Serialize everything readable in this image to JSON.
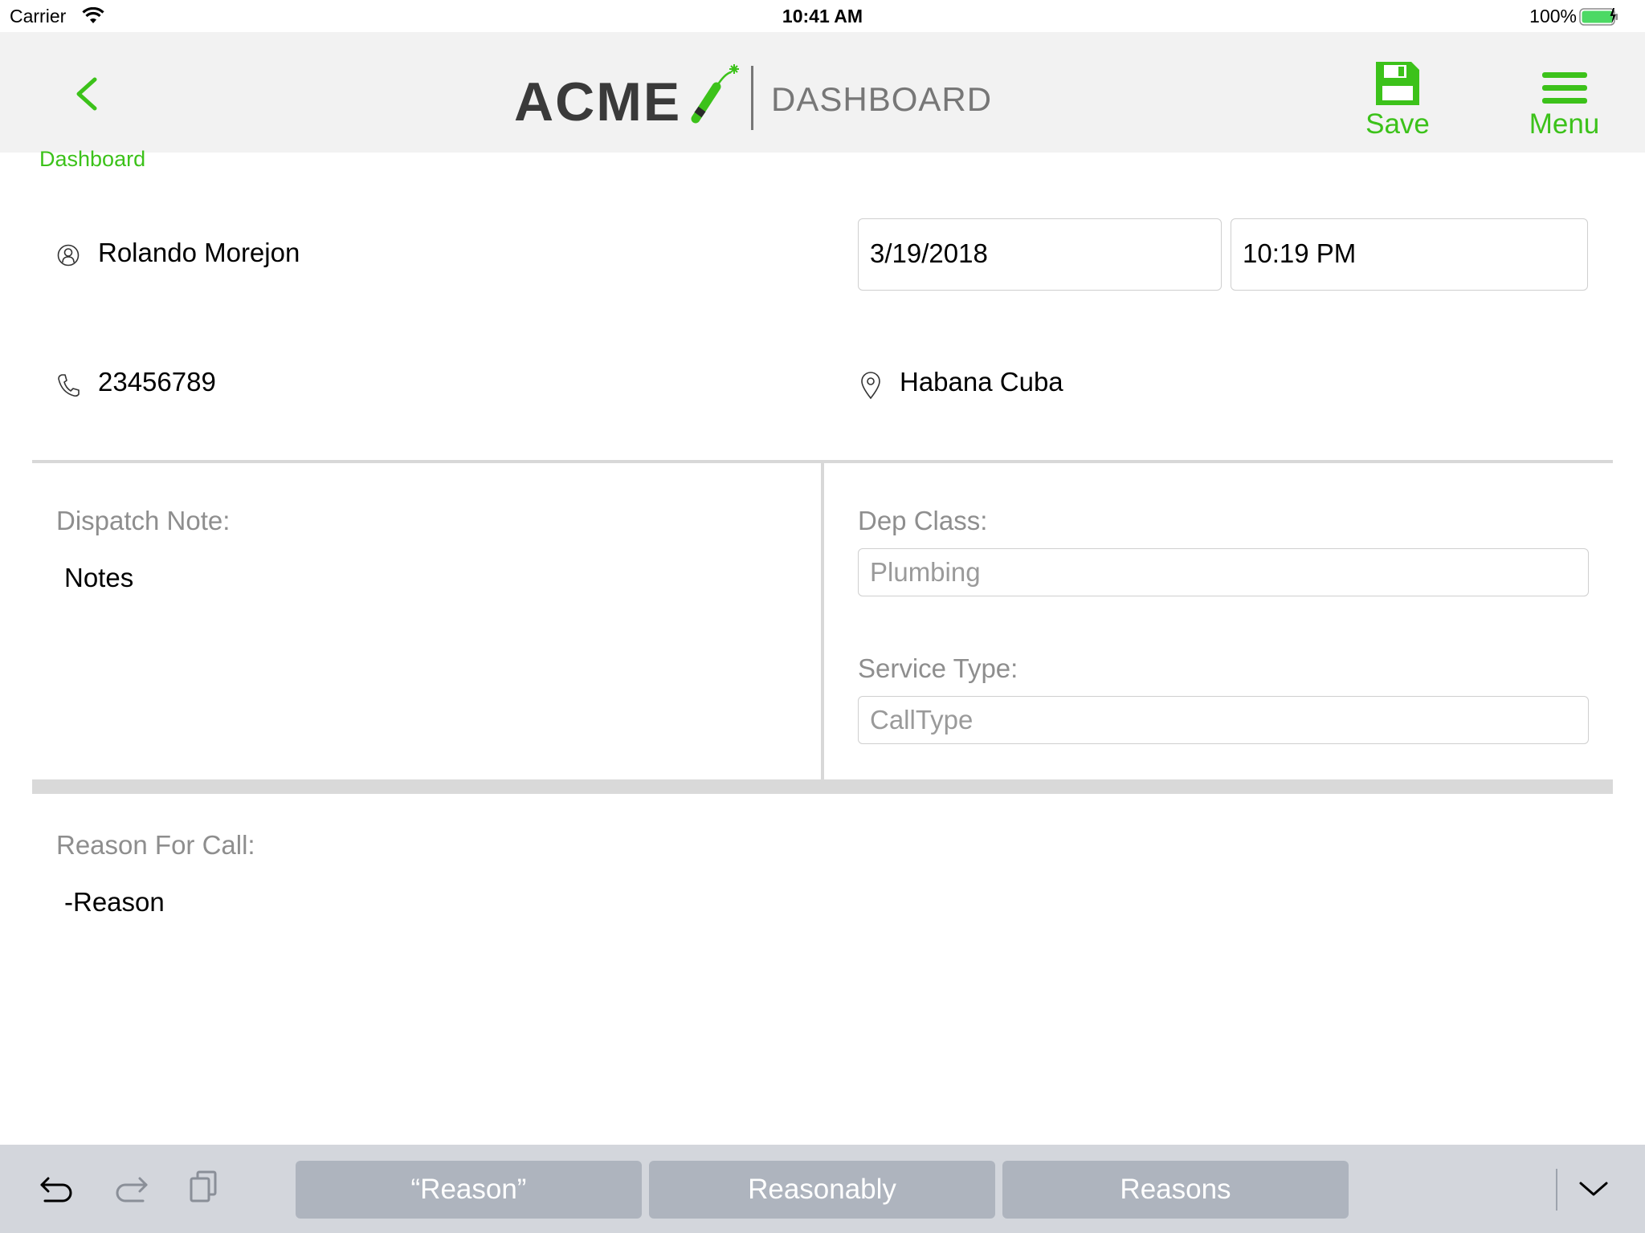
{
  "status_bar": {
    "carrier": "Carrier",
    "time": "10:41 AM",
    "battery": "100%"
  },
  "nav": {
    "back_label": "Dashboard",
    "logo_text": "ACME",
    "section_title": "DASHBOARD",
    "save_label": "Save",
    "menu_label": "Menu",
    "accent_color": "#3cc21a"
  },
  "customer": {
    "name": "Rolando Morejon",
    "phone": "23456789",
    "location": "Habana Cuba",
    "date": "3/19/2018",
    "time": "10:19 PM"
  },
  "dispatch": {
    "note_label": "Dispatch Note:",
    "note_value": "Notes"
  },
  "dep_class": {
    "label": "Dep Class:",
    "placeholder": "Plumbing"
  },
  "service_type": {
    "label": "Service Type:",
    "placeholder": "CallType"
  },
  "reason": {
    "label": "Reason For Call:",
    "value": "-Reason"
  },
  "keyboard": {
    "suggestions": [
      "“Reason”",
      "Reasonably",
      "Reasons"
    ]
  }
}
